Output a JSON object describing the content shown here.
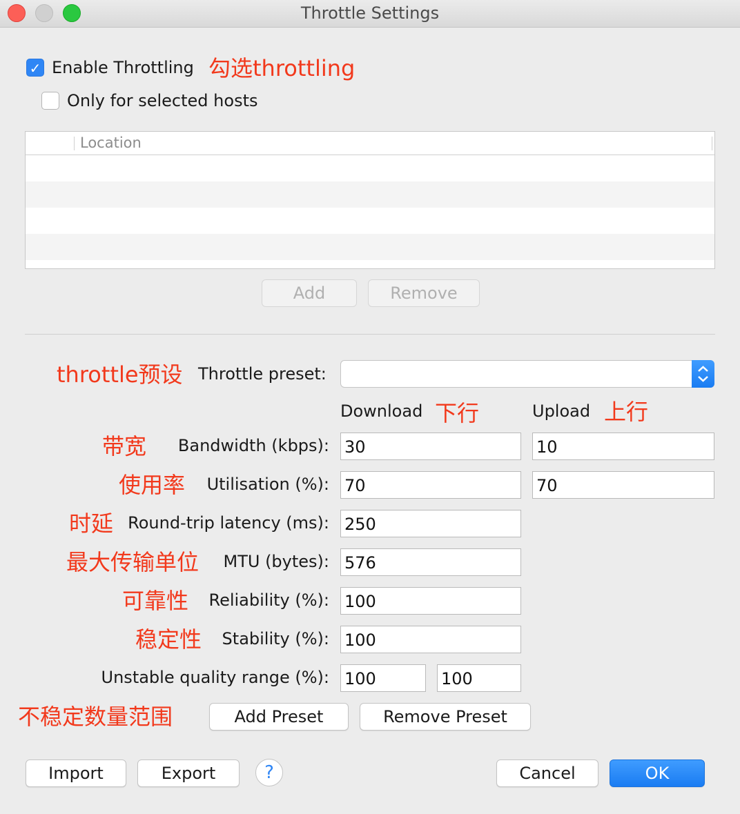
{
  "window": {
    "title": "Throttle Settings"
  },
  "enable_throttling": {
    "label": "Enable Throttling",
    "checked": true,
    "annotation": "勾选throttling"
  },
  "only_selected_hosts": {
    "label": "Only for selected hosts",
    "checked": false
  },
  "hosts_table": {
    "column": "Location",
    "rows": []
  },
  "hosts_buttons": {
    "add": "Add",
    "remove": "Remove"
  },
  "preset": {
    "annotation": "throttle预设",
    "label": "Throttle preset:",
    "value": ""
  },
  "columns": {
    "download": "Download",
    "download_note": "下行",
    "upload": "Upload",
    "upload_note": "上行"
  },
  "fields": {
    "bandwidth": {
      "note": "带宽",
      "label": "Bandwidth (kbps):",
      "download": "30",
      "upload": "10"
    },
    "utilisation": {
      "note": "使用率",
      "label": "Utilisation (%):",
      "download": "70",
      "upload": "70"
    },
    "latency": {
      "note": "时延",
      "label": "Round-trip latency (ms):",
      "value": "250"
    },
    "mtu": {
      "note": "最大传输单位",
      "label": "MTU (bytes):",
      "value": "576"
    },
    "reliability": {
      "note": "可靠性",
      "label": "Reliability (%):",
      "value": "100"
    },
    "stability": {
      "note": "稳定性",
      "label": "Stability (%):",
      "value": "100"
    },
    "unstable": {
      "label": "Unstable quality range (%):",
      "min": "100",
      "max": "100",
      "note": "不稳定数量范围"
    }
  },
  "preset_buttons": {
    "add": "Add Preset",
    "remove": "Remove Preset"
  },
  "footer": {
    "import": "Import",
    "export": "Export",
    "help": "?",
    "cancel": "Cancel",
    "ok": "OK"
  }
}
